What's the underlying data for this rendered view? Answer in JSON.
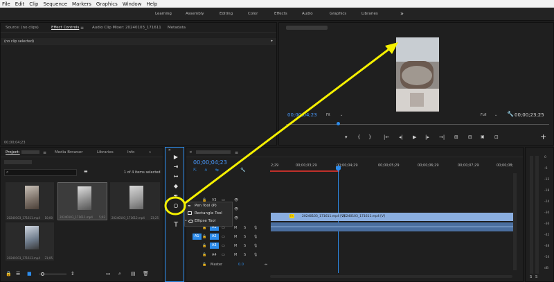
{
  "menu": [
    "File",
    "Edit",
    "Clip",
    "Sequence",
    "Markers",
    "Graphics",
    "Window",
    "Help"
  ],
  "workspaces": [
    "Learning",
    "Assembly",
    "Editing",
    "Color",
    "Effects",
    "Audio",
    "Graphics",
    "Libraries"
  ],
  "overflow_glyph": "»",
  "source_panel": {
    "tabs": [
      "Source: (no clips)",
      "Effect Controls",
      "Audio Clip Mixer: 20240103_171611",
      "Metadata"
    ],
    "menu_glyph": "≡",
    "no_clip": "(no clip selected)",
    "timecode": "00;00;04;23"
  },
  "program": {
    "timecode": "00;00;04;23",
    "fit_label": "Fit",
    "full_label": "Full",
    "duration": "00;00;23;25",
    "controls": [
      "▾",
      "{",
      "}",
      "|←",
      "◂|",
      "▶",
      "|▸",
      "→|",
      "⊞",
      "⊟",
      "📷",
      "⊡"
    ],
    "add_glyph": "+"
  },
  "project": {
    "tabs": [
      "Project:",
      "Media Browser",
      "Libraries",
      "Info"
    ],
    "search_placeholder": "",
    "item_count": "1 of 4 items selected",
    "items": [
      {
        "name": "20240103_171611.mp4",
        "duration": "10;00"
      },
      {
        "name": "20240103_171611.mp4",
        "duration": "5;02"
      },
      {
        "name": "20240103_171612.mp4",
        "duration": "23;25"
      },
      {
        "name": "20240103_171613.mp4",
        "duration": "21;05"
      }
    ]
  },
  "tools": {
    "tools": [
      "▶",
      "⇥",
      "↔",
      "◆",
      "✒",
      "○",
      "T"
    ],
    "menu": [
      "Pen Tool (P)",
      "Rectangle Tool",
      "Ellipse Tool"
    ]
  },
  "timeline": {
    "title": "20240103_171611",
    "timecode": "00;00;04;23",
    "ruler": [
      "2;29",
      "00;00;03;29",
      "00;00;04;29",
      "00;00;05;29",
      "00;00;06;29",
      "00;00;07;29",
      "00;00;08;"
    ],
    "video_tracks": [
      "V3",
      "V2",
      "V1"
    ],
    "audio_tracks": [
      "A1",
      "A2",
      "A3",
      "A4"
    ],
    "source_patch_v": "V1",
    "source_patch_a": "A1",
    "track_buttons": [
      "M",
      "S"
    ],
    "master_label": "Master",
    "master_value": "0.0",
    "clip_v_label": "20240103_171611.mp4 [V]",
    "clip_v_label2": "20240103_171611.mp4 [V]",
    "fx_badge": "fx"
  },
  "meter": {
    "scale": [
      "0",
      "-6",
      "-12",
      "-18",
      "-24",
      "-30",
      "-36",
      "-42",
      "-48",
      "-54",
      "dB"
    ],
    "solo": [
      "S",
      "S"
    ]
  },
  "colors": {
    "accent_blue": "#2d8ceb",
    "annotation_yellow": "#f5f000",
    "clip_blue": "#8aaee0",
    "playhead": "#2d8ceb"
  }
}
